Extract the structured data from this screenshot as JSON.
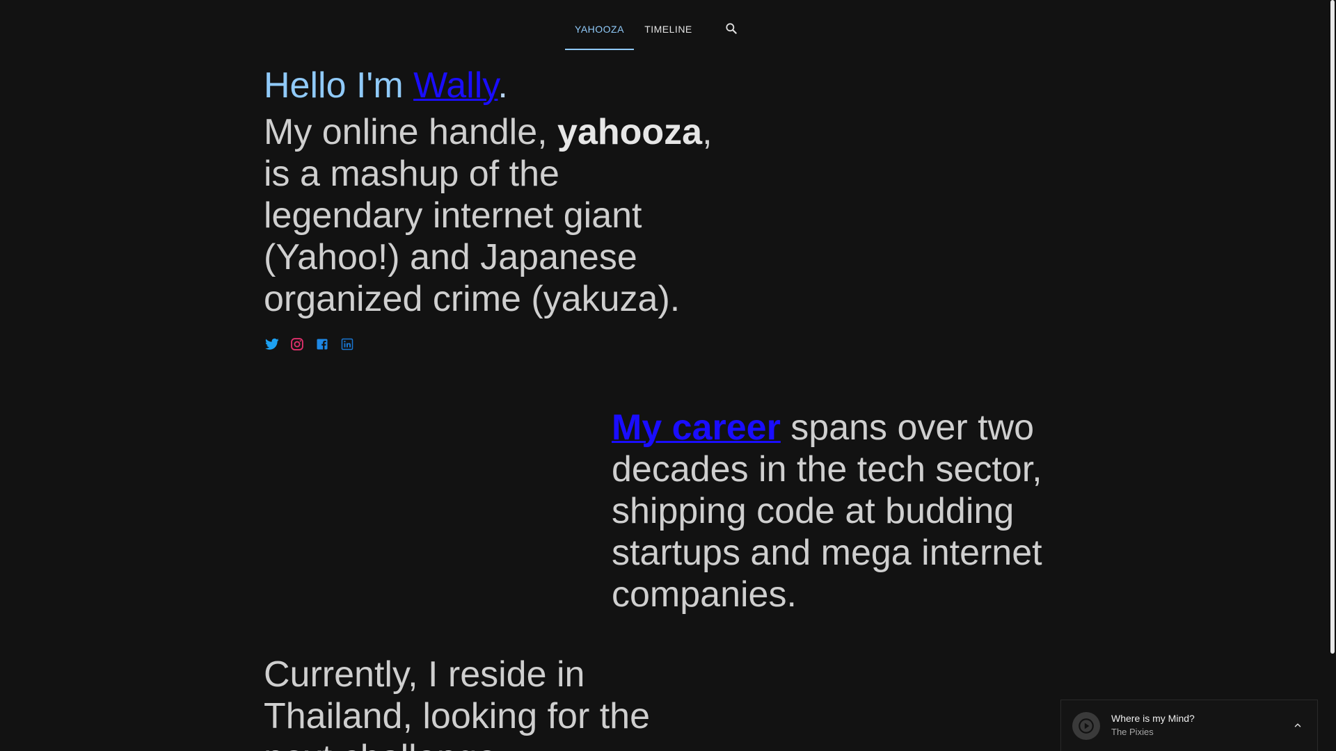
{
  "nav": {
    "tabs": [
      {
        "label": "YAHOOZA",
        "active": true
      },
      {
        "label": "TIMELINE",
        "active": false
      }
    ],
    "search_icon": "search-icon"
  },
  "hero": {
    "hello_prefix": "Hello I'm ",
    "hello_name": "Wally",
    "hello_suffix": "."
  },
  "bio": {
    "part1": "My online handle, ",
    "handle": "yahooza",
    "part2": ",",
    "line2": "is a mashup of the",
    "line3": "legendary internet giant",
    "line4": "(Yahoo!) and Japanese",
    "line5": "organized crime (yakuza)."
  },
  "socials": [
    {
      "name": "twitter-icon",
      "color": "#1da1f2"
    },
    {
      "name": "instagram-icon",
      "color": "#e1306c"
    },
    {
      "name": "facebook-icon",
      "color": "#1e88e5"
    },
    {
      "name": "linkedin-icon",
      "color": "#1976d2"
    }
  ],
  "career": {
    "link": "My career",
    "line1_rest": " spans over two",
    "line2": "decades in the tech sector,",
    "line3": "shipping code at budding",
    "line4": "startups and mega internet",
    "line5": "companies."
  },
  "reside": {
    "line1": "Currently, I reside in",
    "line2": "Thailand, looking for the",
    "line3": "next challenge."
  },
  "player": {
    "title": "Where is my Mind?",
    "artist": "The Pixies"
  },
  "colors": {
    "accent": "#90caf9",
    "link": "#1a0dff",
    "background": "#121212",
    "text": "#cfcfcf"
  }
}
